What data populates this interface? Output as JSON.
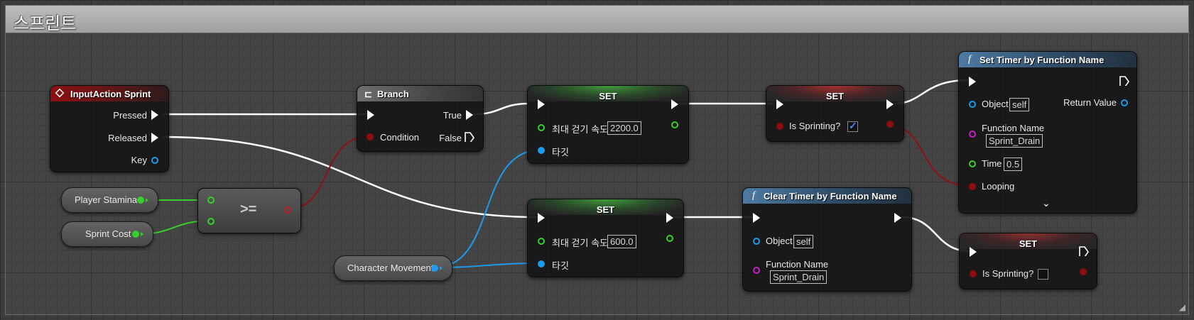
{
  "comment": {
    "title": "스프린트"
  },
  "colors": {
    "exec": "#ffffff",
    "float": "#35d12a",
    "bool": "#8e0d0d",
    "object": "#1c9bed",
    "name": "#c71fc7"
  },
  "input_action": {
    "title": "InputAction Sprint",
    "pins": {
      "pressed": "Pressed",
      "released": "Released",
      "key": "Key"
    }
  },
  "branch": {
    "title": "Branch",
    "condition": "Condition",
    "true_label": "True",
    "false_label": "False"
  },
  "player_stamina": {
    "label": "Player Stamina"
  },
  "sprint_cost": {
    "label": "Sprint Cost"
  },
  "compare": {
    "operator": ">="
  },
  "character_movement": {
    "label": "Character Movement"
  },
  "set_speed_sprint": {
    "title": "SET",
    "field_label": "최대 걷기 속도",
    "value": "2200.0",
    "target_label": "타깃"
  },
  "set_speed_walk": {
    "title": "SET",
    "field_label": "최대 걷기 속도",
    "value": "600.0",
    "target_label": "타깃"
  },
  "set_sprinting_true": {
    "title": "SET",
    "field_label": "Is Sprinting?",
    "checked": true
  },
  "set_sprinting_false": {
    "title": "SET",
    "field_label": "Is Sprinting?",
    "checked": false
  },
  "set_timer": {
    "title": "Set Timer by Function Name",
    "object_label": "Object",
    "object_value": "self",
    "return_label": "Return Value",
    "function_label": "Function Name",
    "function_value": "Sprint_Drain",
    "time_label": "Time",
    "time_value": "0.5",
    "looping_label": "Looping"
  },
  "clear_timer": {
    "title": "Clear Timer by Function Name",
    "object_label": "Object",
    "object_value": "self",
    "function_label": "Function Name",
    "function_value": "Sprint_Drain"
  },
  "icons": {
    "event": "input-event-icon",
    "branch": "branch-icon",
    "function": "function-icon",
    "expand": "chevron-down-icon",
    "resize": "resize-handle-icon"
  }
}
